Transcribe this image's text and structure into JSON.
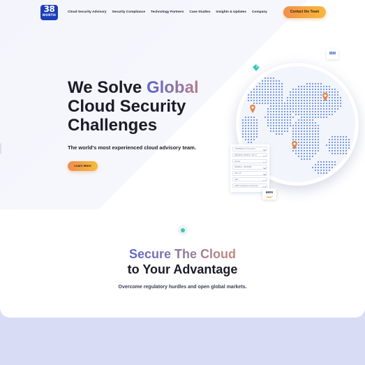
{
  "header": {
    "logo": {
      "number": "38",
      "word": "NORTH"
    },
    "nav": [
      {
        "label": "Cloud Security Advisory"
      },
      {
        "label": "Security Compliance"
      },
      {
        "label": "Technology Partners"
      },
      {
        "label": "Case Studies"
      },
      {
        "label": "Insights & Updates"
      },
      {
        "label": "Company"
      }
    ],
    "cta_label": "Contact the Team"
  },
  "hero": {
    "title_pre": "We Solve ",
    "title_highlight": "Global",
    "title_line2": "Cloud Security",
    "title_line3": "Challenges",
    "subtitle": "The world's most experienced cloud advisory team.",
    "button_label": "Learn More"
  },
  "visual": {
    "ibm_label": "IBM",
    "aws_label": "aws",
    "panel_rows": [
      "COMMERCIAL Frameworks",
      "DEFENSE: GDPR-NL, ISO 27",
      "Federal",
      "FEDERAL - FEDRAMP",
      "DoD, IL5",
      "ITAR",
      "GDPR Compliance & Protection"
    ],
    "colors": {
      "pin": "#e0874a",
      "dots": "#3f6fd1",
      "gem": "#36c6b8"
    }
  },
  "section": {
    "title_highlight": "Secure The Cloud",
    "title_line2": "to Your Advantage",
    "subtitle": "Overcome regulatory hurdles and open global markets."
  }
}
